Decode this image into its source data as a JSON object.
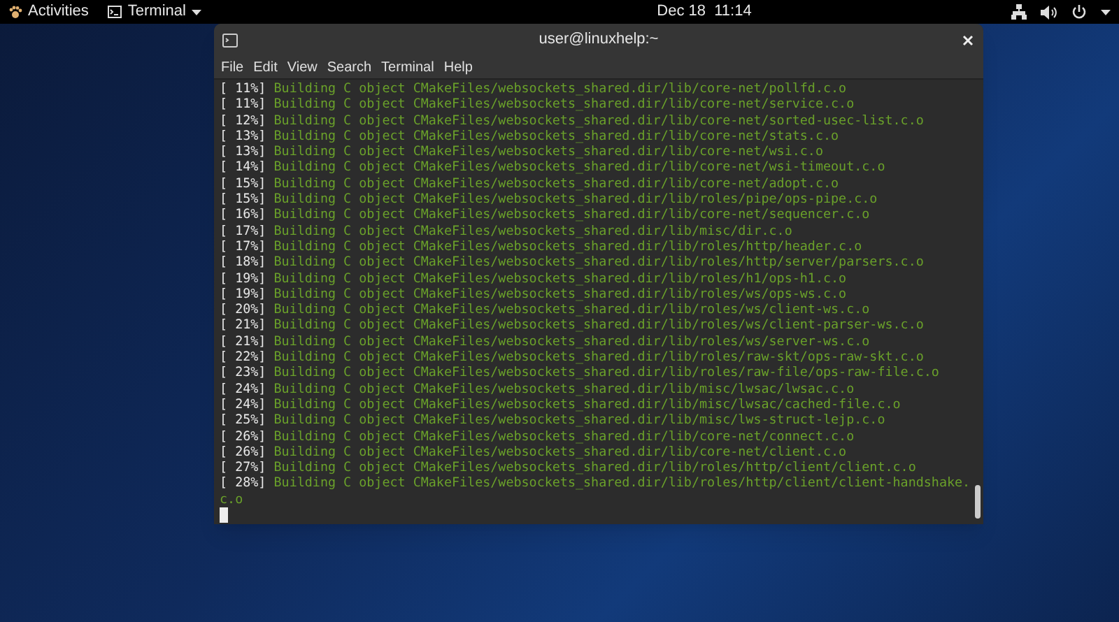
{
  "top_bar": {
    "activities": "Activities",
    "app_menu": "Terminal",
    "clock": "Dec 18  11:14"
  },
  "window": {
    "title": "user@linuxhelp:~",
    "menu": [
      "File",
      "Edit",
      "View",
      "Search",
      "Terminal",
      "Help"
    ],
    "lines": [
      {
        "progress": "[ 11%]",
        "text": "Building C object CMakeFiles/websockets_shared.dir/lib/core-net/pollfd.c.o"
      },
      {
        "progress": "[ 11%]",
        "text": "Building C object CMakeFiles/websockets_shared.dir/lib/core-net/service.c.o"
      },
      {
        "progress": "[ 12%]",
        "text": "Building C object CMakeFiles/websockets_shared.dir/lib/core-net/sorted-usec-list.c.o"
      },
      {
        "progress": "[ 13%]",
        "text": "Building C object CMakeFiles/websockets_shared.dir/lib/core-net/stats.c.o"
      },
      {
        "progress": "[ 13%]",
        "text": "Building C object CMakeFiles/websockets_shared.dir/lib/core-net/wsi.c.o"
      },
      {
        "progress": "[ 14%]",
        "text": "Building C object CMakeFiles/websockets_shared.dir/lib/core-net/wsi-timeout.c.o"
      },
      {
        "progress": "[ 15%]",
        "text": "Building C object CMakeFiles/websockets_shared.dir/lib/core-net/adopt.c.o"
      },
      {
        "progress": "[ 15%]",
        "text": "Building C object CMakeFiles/websockets_shared.dir/lib/roles/pipe/ops-pipe.c.o"
      },
      {
        "progress": "[ 16%]",
        "text": "Building C object CMakeFiles/websockets_shared.dir/lib/core-net/sequencer.c.o"
      },
      {
        "progress": "[ 17%]",
        "text": "Building C object CMakeFiles/websockets_shared.dir/lib/misc/dir.c.o"
      },
      {
        "progress": "[ 17%]",
        "text": "Building C object CMakeFiles/websockets_shared.dir/lib/roles/http/header.c.o"
      },
      {
        "progress": "[ 18%]",
        "text": "Building C object CMakeFiles/websockets_shared.dir/lib/roles/http/server/parsers.c.o"
      },
      {
        "progress": "[ 19%]",
        "text": "Building C object CMakeFiles/websockets_shared.dir/lib/roles/h1/ops-h1.c.o"
      },
      {
        "progress": "[ 19%]",
        "text": "Building C object CMakeFiles/websockets_shared.dir/lib/roles/ws/ops-ws.c.o"
      },
      {
        "progress": "[ 20%]",
        "text": "Building C object CMakeFiles/websockets_shared.dir/lib/roles/ws/client-ws.c.o"
      },
      {
        "progress": "[ 21%]",
        "text": "Building C object CMakeFiles/websockets_shared.dir/lib/roles/ws/client-parser-ws.c.o"
      },
      {
        "progress": "[ 21%]",
        "text": "Building C object CMakeFiles/websockets_shared.dir/lib/roles/ws/server-ws.c.o"
      },
      {
        "progress": "[ 22%]",
        "text": "Building C object CMakeFiles/websockets_shared.dir/lib/roles/raw-skt/ops-raw-skt.c.o"
      },
      {
        "progress": "[ 23%]",
        "text": "Building C object CMakeFiles/websockets_shared.dir/lib/roles/raw-file/ops-raw-file.c.o"
      },
      {
        "progress": "[ 24%]",
        "text": "Building C object CMakeFiles/websockets_shared.dir/lib/misc/lwsac/lwsac.c.o"
      },
      {
        "progress": "[ 24%]",
        "text": "Building C object CMakeFiles/websockets_shared.dir/lib/misc/lwsac/cached-file.c.o"
      },
      {
        "progress": "[ 25%]",
        "text": "Building C object CMakeFiles/websockets_shared.dir/lib/misc/lws-struct-lejp.c.o"
      },
      {
        "progress": "[ 26%]",
        "text": "Building C object CMakeFiles/websockets_shared.dir/lib/core-net/connect.c.o"
      },
      {
        "progress": "[ 26%]",
        "text": "Building C object CMakeFiles/websockets_shared.dir/lib/core-net/client.c.o"
      },
      {
        "progress": "[ 27%]",
        "text": "Building C object CMakeFiles/websockets_shared.dir/lib/roles/http/client/client.c.o"
      },
      {
        "progress": "[ 28%]",
        "text": "Building C object CMakeFiles/websockets_shared.dir/lib/roles/http/client/client-handshake.c.o"
      }
    ]
  }
}
